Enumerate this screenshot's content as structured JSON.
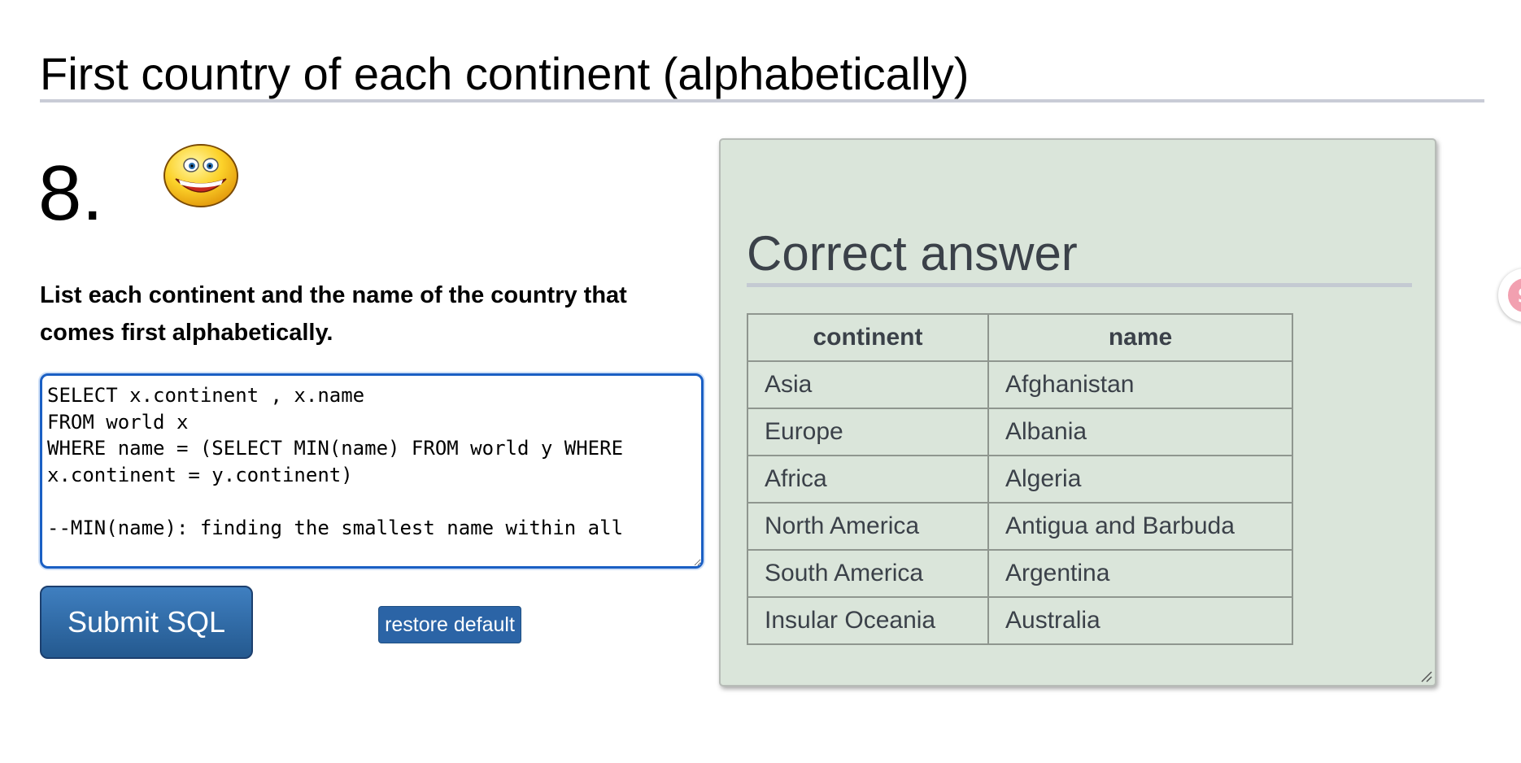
{
  "page": {
    "title": "First country of each continent (alphabetically)",
    "question_number": "8.",
    "question_text": "List each continent and the name of the country that comes first alphabetically."
  },
  "editor": {
    "value": "SELECT x.continent , x.name\nFROM world x\nWHERE name = (SELECT MIN(name) FROM world y WHERE x.continent = y.continent)\n\n--MIN(name): finding the smallest name within all"
  },
  "buttons": {
    "submit_label": "Submit SQL",
    "restore_label": "restore default"
  },
  "answer": {
    "title": "Correct answer",
    "columns": [
      "continent",
      "name"
    ],
    "rows": [
      [
        "Asia",
        "Afghanistan"
      ],
      [
        "Europe",
        "Albania"
      ],
      [
        "Africa",
        "Algeria"
      ],
      [
        "North America",
        "Antigua and Barbuda"
      ],
      [
        "South America",
        "Argentina"
      ],
      [
        "Insular Oceania",
        "Australia"
      ]
    ]
  },
  "side_widget": {
    "glyph": "$"
  },
  "colors": {
    "panel_bg": "#dae5da",
    "button_blue": "#2b64a6",
    "editor_border": "#1a5fc4"
  },
  "icons": {
    "status": "grinning-smiley-icon",
    "side": "dollar-icon"
  }
}
